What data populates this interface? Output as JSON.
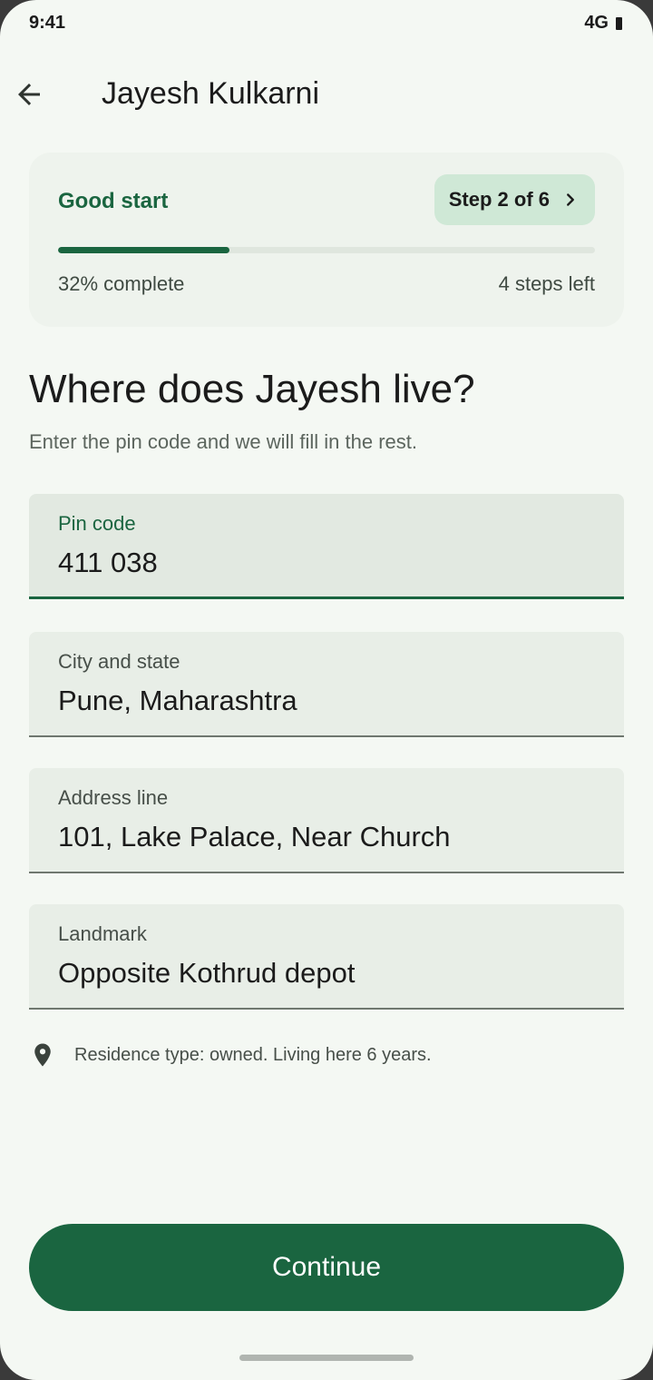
{
  "status_bar": {
    "time": "9:41",
    "network": "4G"
  },
  "app_bar": {
    "title": "Jayesh Kulkarni",
    "back_icon": "arrow-back-icon"
  },
  "progress": {
    "title": "Good start",
    "step_label": "Step 2 of 6",
    "percent_label": "32% complete",
    "percent_value": 32,
    "steps_left_label": "4 steps left"
  },
  "question": {
    "heading": "Where does Jayesh live?",
    "subtitle": "Enter the pin code and we will fill in the rest."
  },
  "fields": [
    {
      "label": "Pin code",
      "value": "411 038",
      "active": true
    },
    {
      "label": "City and state",
      "value": "Pune, Maharashtra"
    },
    {
      "label": "Address line",
      "value": "101, Lake Palace, Near Church"
    },
    {
      "label": "Landmark",
      "value": "Opposite Kothrud depot"
    }
  ],
  "note": {
    "icon": "location-pin-icon",
    "text": "Residence type: owned. Living here 6 years."
  },
  "actions": {
    "continue_label": "Continue"
  },
  "colors": {
    "accent": "#1a6540",
    "background": "#f4f8f3",
    "chip": "#cfe8d6"
  }
}
